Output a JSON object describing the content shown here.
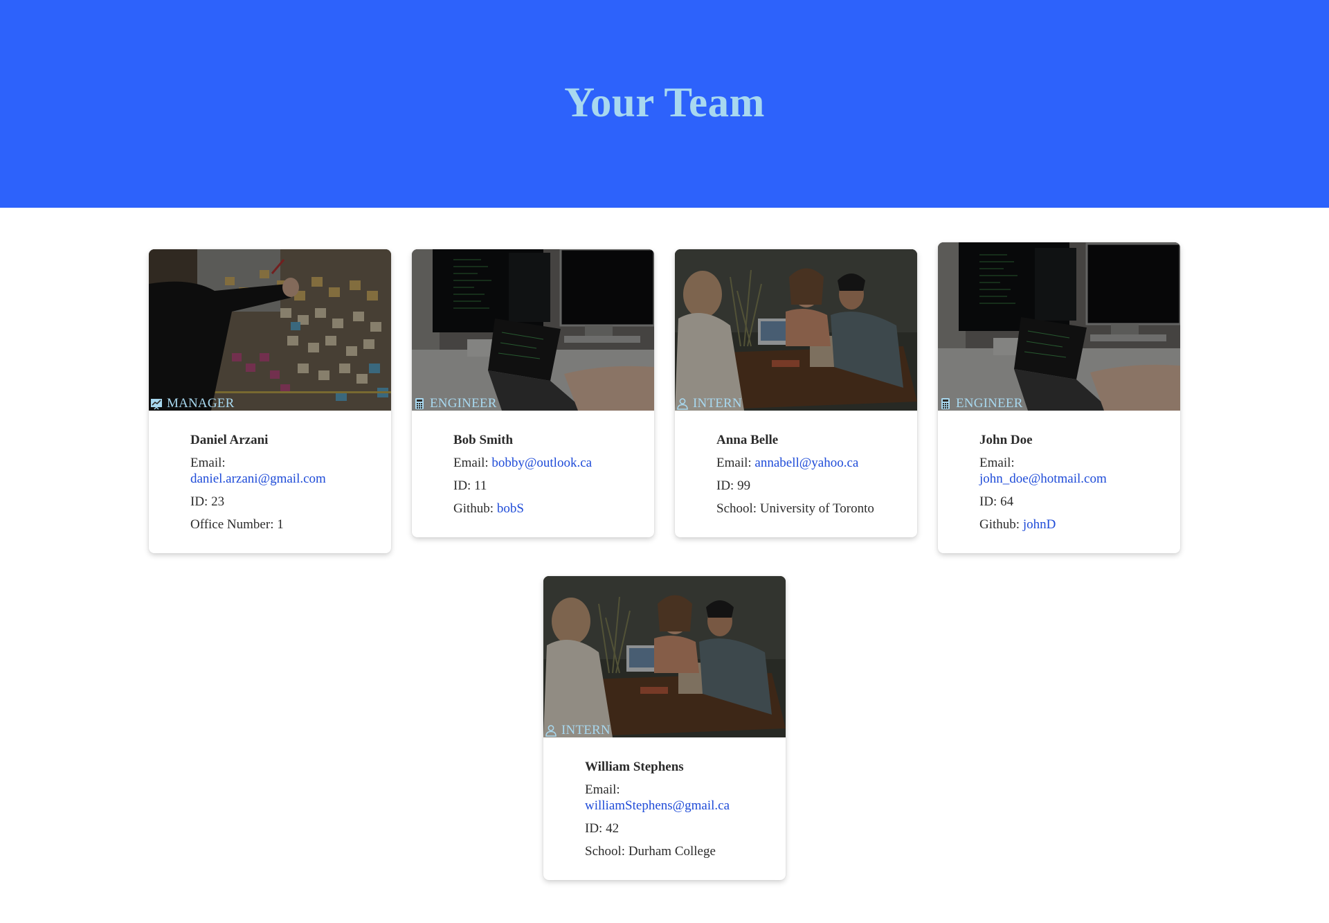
{
  "header": {
    "title": "Your Team"
  },
  "labels": {
    "email": "Email:",
    "id": "ID:",
    "office": "Office Number:",
    "github": "Github:",
    "school": "School:"
  },
  "cards": [
    {
      "role": "MANAGER",
      "role_icon": "chart-icon",
      "image": "sticky-notes-board-photo",
      "name": "Daniel Arzani",
      "email": "daniel.arzani@gmail.com",
      "id": "23",
      "office": "1"
    },
    {
      "role": "ENGINEER",
      "role_icon": "calculator-icon",
      "image": "computer-desk-photo",
      "name": "Bob Smith",
      "email": "bobby@outlook.ca",
      "id": "11",
      "github": "bobS"
    },
    {
      "role": "INTERN",
      "role_icon": "person-icon",
      "image": "students-cafe-photo",
      "name": "Anna Belle",
      "email": "annabell@yahoo.ca",
      "id": "99",
      "school": "University of Toronto"
    },
    {
      "role": "ENGINEER",
      "role_icon": "calculator-icon",
      "image": "computer-desk-photo",
      "name": "John Doe",
      "email": "john_doe@hotmail.com",
      "id": "64",
      "github": "johnD"
    },
    {
      "role": "INTERN",
      "role_icon": "person-icon",
      "image": "students-cafe-photo",
      "name": "William Stephens",
      "email": "williamStephens@gmail.ca",
      "id": "42",
      "school": "Durham College"
    }
  ],
  "colors": {
    "header_bg": "#2d62fb",
    "title": "#a8d8ef",
    "link": "#1e4bd8",
    "role_label": "#a8d8ef"
  }
}
